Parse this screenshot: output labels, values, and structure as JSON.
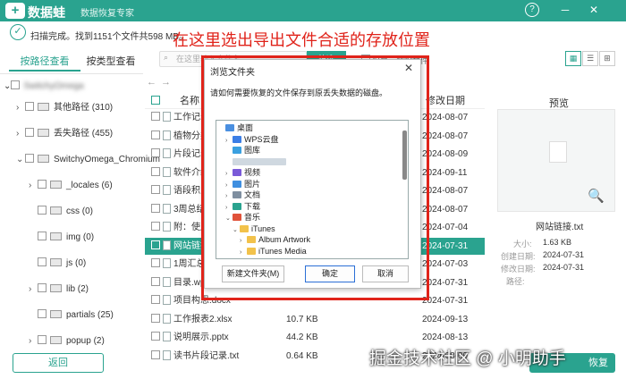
{
  "app": {
    "logo_glyph": "+",
    "name": "数据蛙",
    "subtitle": "数据恢复专家",
    "help": "?",
    "minimize": "─",
    "close": "✕"
  },
  "status": {
    "check_glyph": "✓",
    "text": "扫描完成。找到1151个文件共598 MB。"
  },
  "instruction": "在这里选出导出文件合适的存放位置",
  "tabs": [
    {
      "label": "按路径查看",
      "active": true
    },
    {
      "label": "按类型查看",
      "active": false
    }
  ],
  "search": {
    "placeholder": "在这里输入文件名",
    "button": "筛选"
  },
  "option_label": "仅显示删除文件",
  "views": [
    "▦",
    "☰",
    "⊞"
  ],
  "tree": {
    "root": "SwitchyOmega",
    "items": [
      {
        "label": "其他路径 (310)",
        "indent": 1,
        "arrow": "›"
      },
      {
        "label": "丢失路径 (455)",
        "indent": 1,
        "arrow": "›"
      },
      {
        "label": "SwitchyOmega_Chromium",
        "indent": 1,
        "arrow": "⌄"
      },
      {
        "label": "_locales (6)",
        "indent": 2,
        "arrow": "›"
      },
      {
        "label": "css (0)",
        "indent": 2,
        "arrow": ""
      },
      {
        "label": "img (0)",
        "indent": 2,
        "arrow": ""
      },
      {
        "label": "js (0)",
        "indent": 2,
        "arrow": ""
      },
      {
        "label": "lib (2)",
        "indent": 2,
        "arrow": "›"
      },
      {
        "label": "partials (25)",
        "indent": 2,
        "arrow": ""
      },
      {
        "label": "popup (2)",
        "indent": 2,
        "arrow": "›"
      }
    ]
  },
  "table": {
    "headers": {
      "name": "名称",
      "size": "大小",
      "modified": "修改日期"
    },
    "rows": [
      {
        "name": "工作记录表.xlsx",
        "size": "",
        "date": "2024-08-07",
        "selected": false
      },
      {
        "name": "植物分类.docx",
        "size": "",
        "date": "2024-08-07",
        "selected": false
      },
      {
        "name": "片段记录.txt",
        "size": "",
        "date": "2024-08-09",
        "selected": false
      },
      {
        "name": "软件介绍.docx",
        "size": "",
        "date": "2024-09-11",
        "selected": false
      },
      {
        "name": "语段积累.docx",
        "size": "",
        "date": "2024-08-07",
        "selected": false
      },
      {
        "name": "3周总结.docx",
        "size": "",
        "date": "2024-08-07",
        "selected": false
      },
      {
        "name": "附：使用手册.docx",
        "size": "",
        "date": "2024-07-04",
        "selected": false
      },
      {
        "name": "网站链接.txt",
        "size": "",
        "date": "2024-07-31",
        "selected": true
      },
      {
        "name": "1周汇总.docx",
        "size": "",
        "date": "2024-07-03",
        "selected": false
      },
      {
        "name": "目录.wps",
        "size": "",
        "date": "2024-07-31",
        "selected": false
      },
      {
        "name": "项目构思.docx",
        "size": "",
        "date": "2024-07-31",
        "selected": false
      },
      {
        "name": "工作报表2.xlsx",
        "size": "10.7 KB",
        "date": "2024-09-13",
        "selected": false
      },
      {
        "name": "说明展示.pptx",
        "size": "44.2 KB",
        "date": "2024-08-13",
        "selected": false
      },
      {
        "name": "读书片段记录.txt",
        "size": "0.64 KB",
        "date": "2024-08-09",
        "selected": false
      }
    ]
  },
  "preview": {
    "title": "预览",
    "zoom_glyph": "🔍",
    "file_name": "网站链接.txt",
    "meta": [
      {
        "label": "大小:",
        "value": "1.63 KB"
      },
      {
        "label": "创建日期:",
        "value": "2024-07-31"
      },
      {
        "label": "修改日期:",
        "value": "2024-07-31"
      },
      {
        "label": "路径:",
        "value": ""
      }
    ]
  },
  "dialog": {
    "title": "浏览文件夹",
    "close": "✕",
    "prompt": "请如何需要恢复的文件保存到原丢失数据的磁盘。",
    "nodes": [
      {
        "label": "桌面",
        "depth": 0,
        "arrow": "",
        "color": "#4a8fe0"
      },
      {
        "label": "WPS云盘",
        "depth": 1,
        "arrow": "›",
        "color": "#3b7ee6"
      },
      {
        "label": "图库",
        "depth": 1,
        "arrow": "",
        "color": "#3aa0e0"
      },
      {
        "label": "",
        "depth": 1,
        "arrow": "",
        "color": "#cfd8e0"
      },
      {
        "label": "视频",
        "depth": 1,
        "arrow": "›",
        "color": "#7a5ad8"
      },
      {
        "label": "图片",
        "depth": 1,
        "arrow": "›",
        "color": "#3f8fe0"
      },
      {
        "label": "文档",
        "depth": 1,
        "arrow": "›",
        "color": "#7f8fa0"
      },
      {
        "label": "下载",
        "depth": 1,
        "arrow": "›",
        "color": "#2aa38f"
      },
      {
        "label": "音乐",
        "depth": 1,
        "arrow": "⌄",
        "color": "#e0523a"
      },
      {
        "label": "iTunes",
        "depth": 2,
        "arrow": "⌄",
        "color": "#f2c24b"
      },
      {
        "label": "Album Artwork",
        "depth": 3,
        "arrow": "›",
        "color": "#f2c24b"
      },
      {
        "label": "iTunes Media",
        "depth": 3,
        "arrow": "›",
        "color": "#f2c24b"
      }
    ],
    "buttons": {
      "new_folder": "新建文件夹(M)",
      "ok": "确定",
      "cancel": "取消"
    }
  },
  "footer": {
    "back": "返回",
    "recover": "恢复"
  },
  "watermark": "掘金技术社区 @ 小明助手",
  "colors": {
    "accent": "#2aa38f",
    "highlight_red": "#e0231a"
  }
}
